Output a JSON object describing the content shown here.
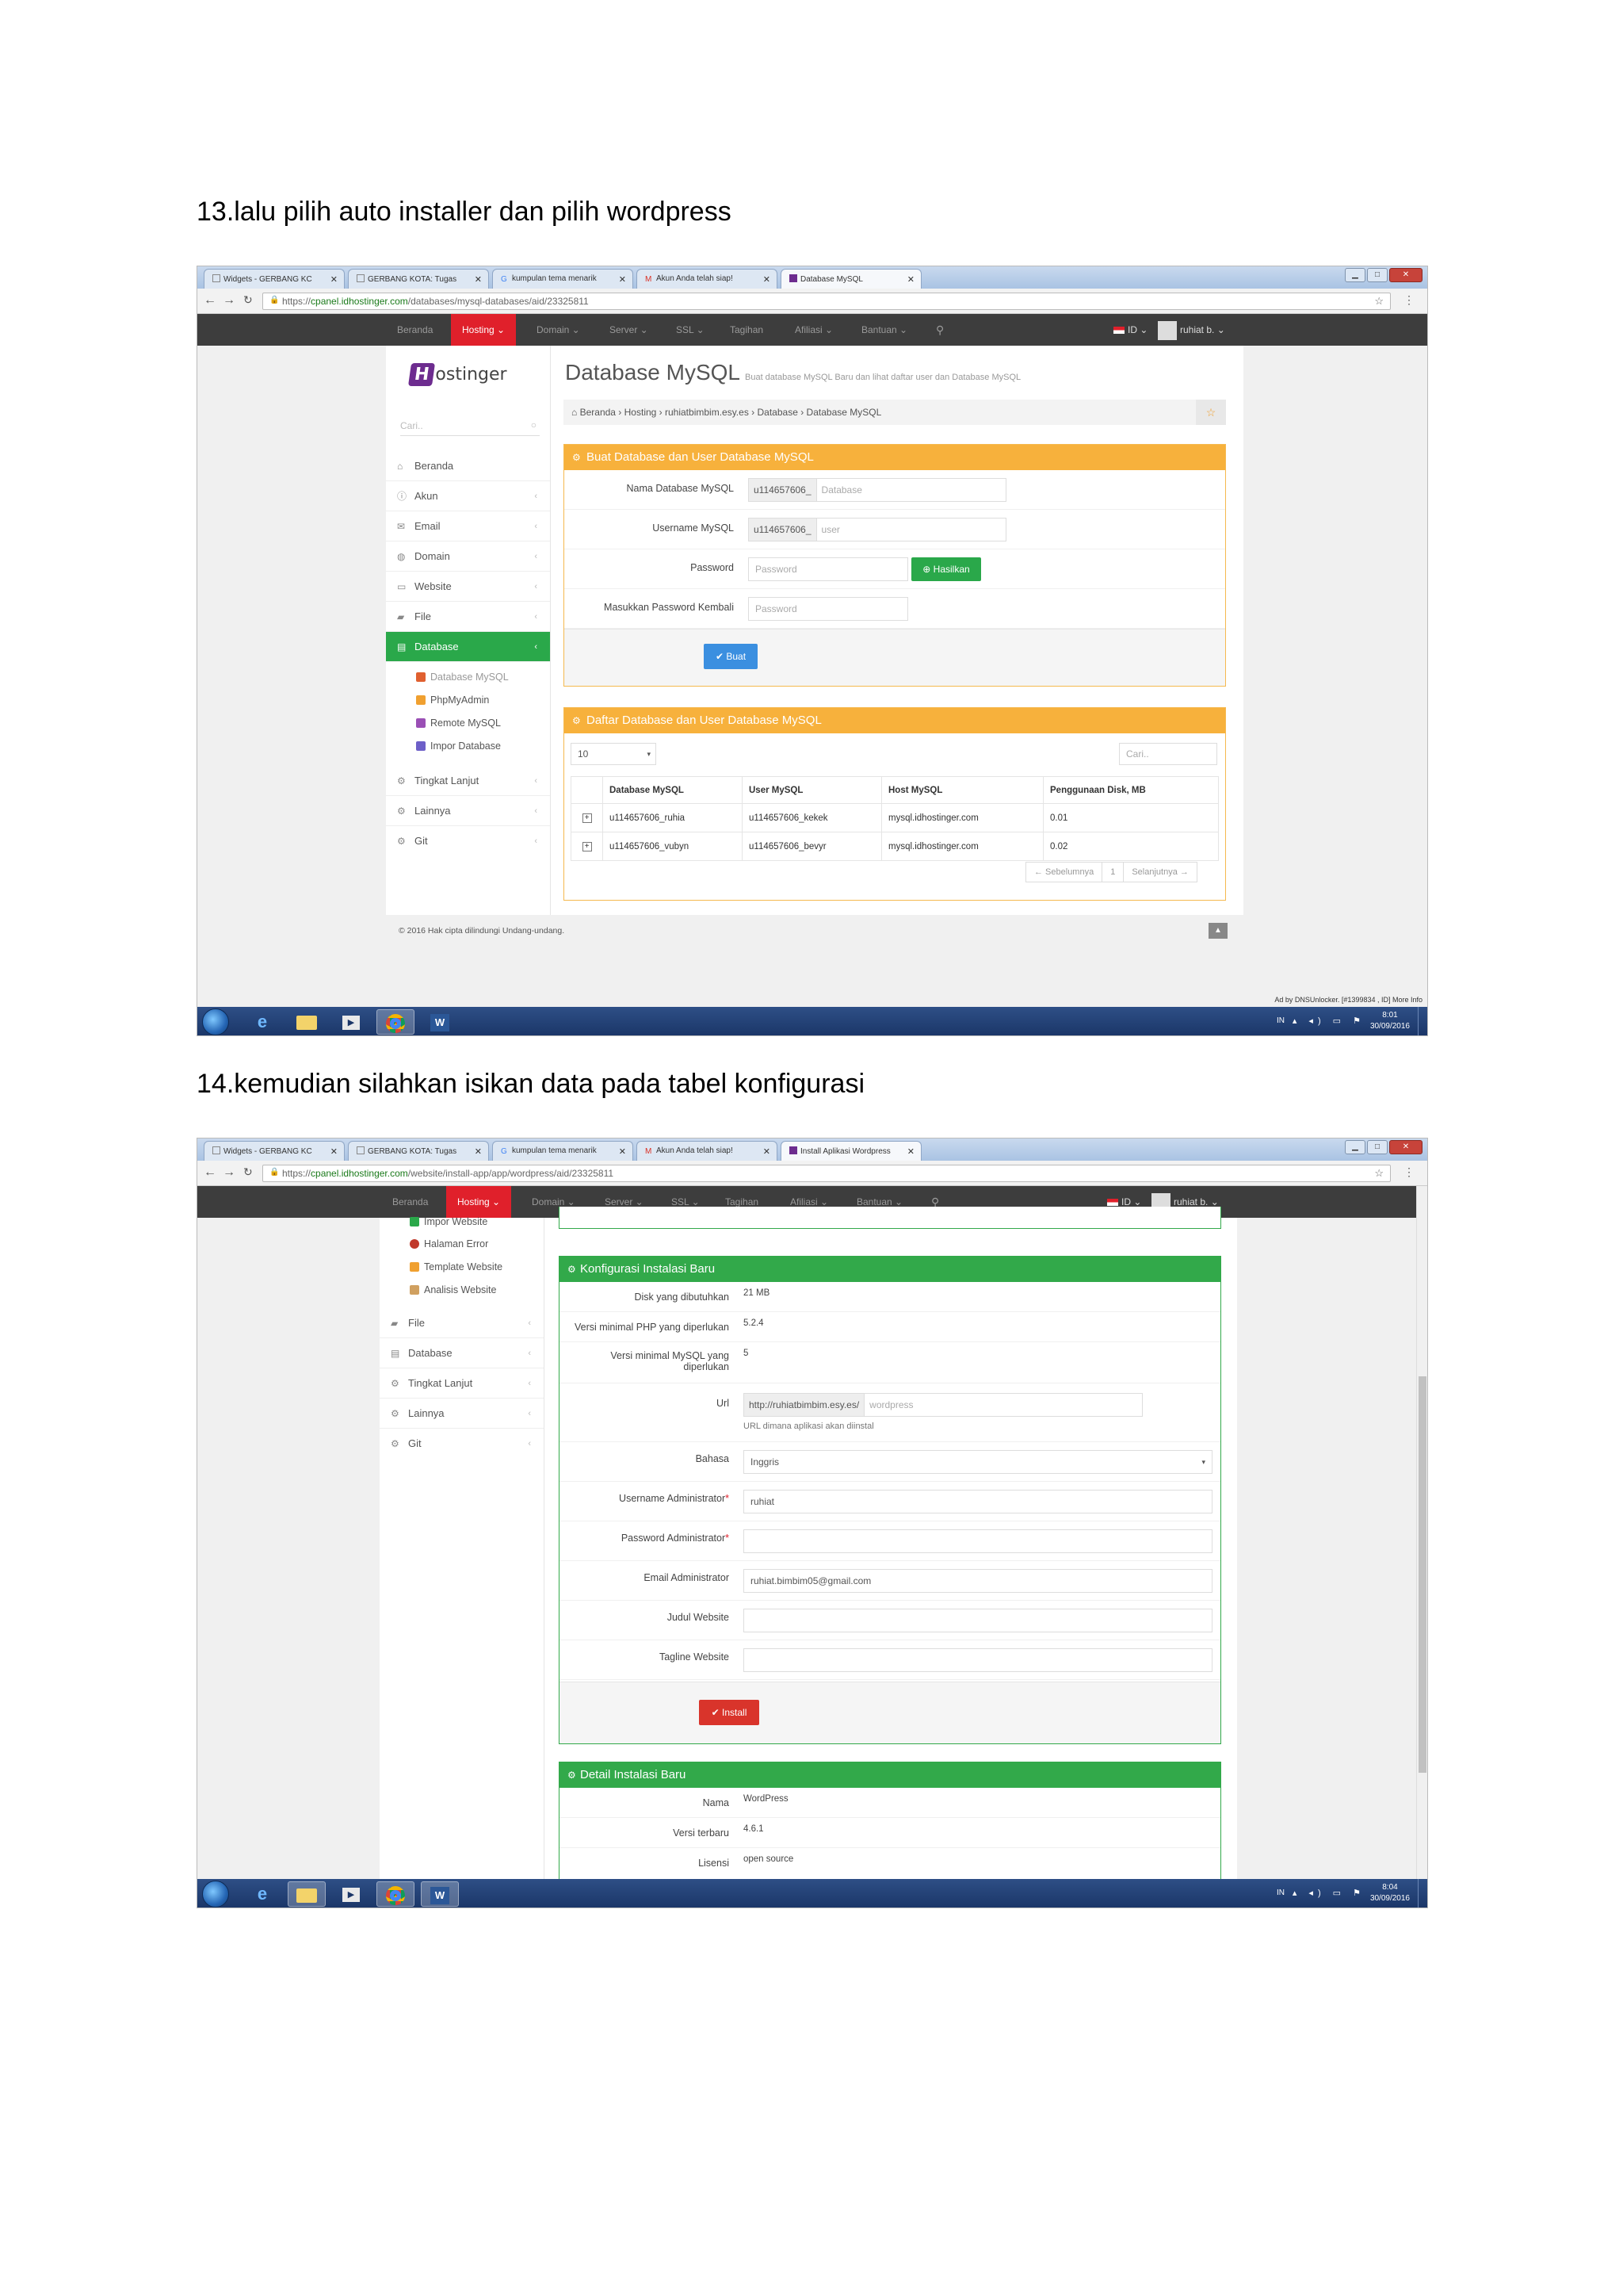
{
  "doc": {
    "step13": "13.lalu pilih auto installer dan pilih wordpress",
    "step14": "14.kemudian silahkan isikan data pada tabel konfigurasi"
  },
  "browser1": {
    "tabs": [
      "Widgets - GERBANG KC",
      "GERBANG KOTA: Tugas",
      "kumpulan tema menarik",
      "Akun Anda telah siap!",
      "Database MySQL"
    ],
    "url_prefix": "https://",
    "url_host": "cpanel.idhostinger.com",
    "url_path": "/databases/mysql-databases/aid/23325811"
  },
  "browser2": {
    "tabs": [
      "Widgets - GERBANG KC",
      "GERBANG KOTA: Tugas",
      "kumpulan tema menarik",
      "Akun Anda telah siap!",
      "Install Aplikasi Wordpress"
    ],
    "url_prefix": "https://",
    "url_host": "cpanel.idhostinger.com",
    "url_path": "/website/install-app/app/wordpress/aid/23325811"
  },
  "topnav": {
    "items": [
      "Beranda",
      "Hosting ⌄",
      "Domain ⌄",
      "Server ⌄",
      "SSL ⌄",
      "Tagihan",
      "Afiliasi ⌄",
      "Bantuan ⌄"
    ],
    "lang": "ID ⌄",
    "user": "ruhiat b. ⌄"
  },
  "logo": {
    "mark": "H",
    "text": "ostinger"
  },
  "sidebar": {
    "search_placeholder": "Cari..",
    "items": [
      "Beranda",
      "Akun",
      "Email",
      "Domain",
      "Website",
      "File",
      "Database",
      "Tingkat Lanjut",
      "Lainnya",
      "Git"
    ],
    "db_sub": [
      "Database MySQL",
      "PhpMyAdmin",
      "Remote MySQL",
      "Impor Database"
    ],
    "website_sub": [
      "Impor Website",
      "Halaman Error",
      "Template Website",
      "Analisis Website"
    ]
  },
  "page1": {
    "title": "Database MySQL",
    "subtitle": "Buat database MySQL Baru dan lihat daftar user dan Database MySQL",
    "breadcrumb": [
      "Beranda",
      "Hosting",
      "ruhiatbimbim.esy.es",
      "Database",
      "Database MySQL"
    ],
    "create_box": {
      "title": "Buat Database dan User Database MySQL",
      "db_label": "Nama Database MySQL",
      "db_prefix": "u114657606_",
      "db_placeholder": "Database",
      "user_label": "Username MySQL",
      "user_prefix": "u114657606_",
      "user_placeholder": "user",
      "pass_label": "Password",
      "pass_placeholder": "Password",
      "generate": "Hasilkan",
      "repass_label": "Masukkan Password Kembali",
      "repass_placeholder": "Password",
      "submit": "Buat"
    },
    "list_box": {
      "title": "Daftar Database dan User Database MySQL",
      "page_size": "10",
      "search_placeholder": "Cari..",
      "columns": [
        "Database MySQL",
        "User MySQL",
        "Host MySQL",
        "Penggunaan Disk, MB"
      ],
      "rows": [
        [
          "u114657606_ruhia",
          "u114657606_kekek",
          "mysql.idhostinger.com",
          "0.01"
        ],
        [
          "u114657606_vubyn",
          "u114657606_bevyr",
          "mysql.idhostinger.com",
          "0.02"
        ]
      ],
      "prev": "← Sebelumnya",
      "page": "1",
      "next": "Selanjutnya →"
    },
    "copyright": "© 2016 Hak cipta dilindungi Undang-undang.",
    "ad": "Ad by DNSUnlocker. [#1399834 , ID] More Info"
  },
  "page2": {
    "config_box": {
      "title": "Konfigurasi Instalasi Baru",
      "rows": [
        {
          "label": "Disk yang dibutuhkan",
          "value": "21 MB"
        },
        {
          "label": "Versi minimal PHP yang diperlukan",
          "value": "5.2.4"
        },
        {
          "label": "Versi minimal MySQL yang diperlukan",
          "value": "5"
        }
      ],
      "url_label": "Url",
      "url_prefix": "http://ruhiatbimbim.esy.es/",
      "url_value": "wordpress",
      "url_help": "URL dimana aplikasi akan diinstal",
      "lang_label": "Bahasa",
      "lang_value": "Inggris",
      "admin_user_label": "Username Administrator",
      "admin_user_value": "ruhiat",
      "admin_pass_label": "Password Administrator",
      "admin_email_label": "Email Administrator",
      "admin_email_value": "ruhiat.bimbim05@gmail.com",
      "site_title_label": "Judul Website",
      "tagline_label": "Tagline Website",
      "install": "Install"
    },
    "detail_box": {
      "title": "Detail Instalasi Baru",
      "rows": [
        {
          "label": "Nama",
          "value": "WordPress"
        },
        {
          "label": "Versi terbaru",
          "value": "4.6.1"
        },
        {
          "label": "Lisensi",
          "value": "open source"
        }
      ]
    }
  },
  "taskbar1": {
    "lang": "IN",
    "time": "8:01",
    "date": "30/09/2016"
  },
  "taskbar2": {
    "lang": "IN",
    "time": "8:04",
    "date": "30/09/2016"
  },
  "colors": {
    "hostinger_red": "#e0202b",
    "green": "#2aa84a",
    "orange": "#f7b13c",
    "purple": "#6d2c8f"
  }
}
